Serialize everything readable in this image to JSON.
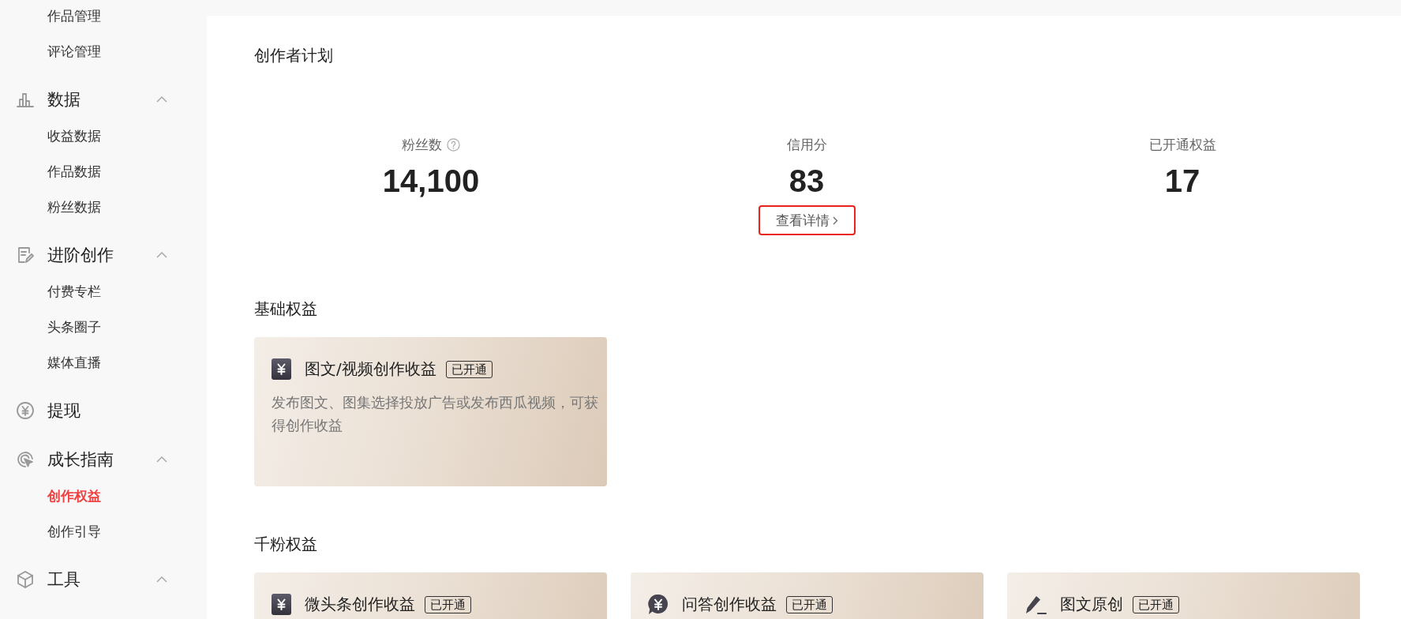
{
  "sidebar": {
    "sections": [
      {
        "kind": "group",
        "items": [
          {
            "label": "作品管理",
            "selected": false
          },
          {
            "label": "评论管理",
            "selected": false
          }
        ]
      },
      {
        "kind": "group",
        "title": "数据",
        "expanded": true,
        "items": [
          {
            "label": "收益数据",
            "selected": false
          },
          {
            "label": "作品数据",
            "selected": false
          },
          {
            "label": "粉丝数据",
            "selected": false
          }
        ]
      },
      {
        "kind": "group",
        "title": "进阶创作",
        "expanded": true,
        "items": [
          {
            "label": "付费专栏",
            "selected": false
          },
          {
            "label": "头条圈子",
            "selected": false
          },
          {
            "label": "媒体直播",
            "selected": false
          }
        ]
      },
      {
        "kind": "link",
        "title": "提现"
      },
      {
        "kind": "group",
        "title": "成长指南",
        "expanded": true,
        "items": [
          {
            "label": "创作权益",
            "selected": true
          },
          {
            "label": "创作引导",
            "selected": false
          }
        ]
      },
      {
        "kind": "group",
        "title": "工具",
        "expanded": true
      }
    ]
  },
  "page_title": "创作者计划",
  "stats": [
    {
      "label": "粉丝数",
      "help": true,
      "value": "14,100"
    },
    {
      "label": "信用分",
      "value": "83",
      "link": {
        "label": "查看详情",
        "highlighted": true
      }
    },
    {
      "label": "已开通权益",
      "value": "17"
    }
  ],
  "sections": [
    {
      "title": "基础权益",
      "cards": [
        {
          "title": "图文/视频创作收益",
          "badge": "已开通",
          "description": "发布图文、图集选择投放广告或发布西瓜视频，可获得创作收益"
        }
      ]
    },
    {
      "title": "千粉权益",
      "cards": [
        {
          "title": "微头条创作收益",
          "badge": "已开通"
        },
        {
          "title": "问答创作收益",
          "badge": "已开通"
        },
        {
          "title": "图文原创",
          "badge": "已开通"
        }
      ]
    }
  ]
}
